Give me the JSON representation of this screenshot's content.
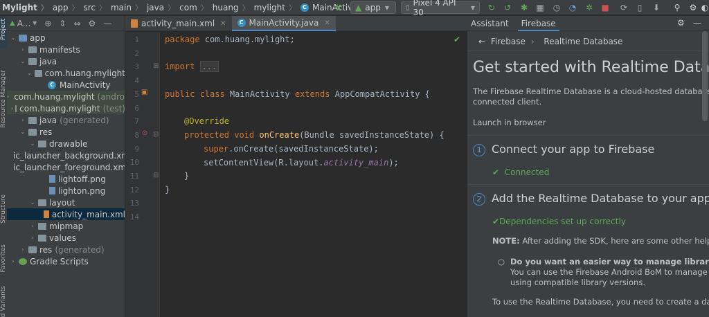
{
  "breadcrumb": [
    "Mylight",
    "app",
    "src",
    "main",
    "java",
    "com",
    "huang",
    "mylight",
    "MainActivity"
  ],
  "toolbar": {
    "config": "app",
    "device": "Pixel 4 API 30"
  },
  "left_strip": {
    "project": "Project",
    "resource_manager": "Resource Manager",
    "structure": "Structure",
    "favorites": "Favorites",
    "build_variants": "Build Variants"
  },
  "project_panel": {
    "title": "A..."
  },
  "tree": [
    {
      "label": "app",
      "level": 0,
      "type": "folder-blue",
      "expanded": true
    },
    {
      "label": "manifests",
      "level": 1,
      "type": "folder",
      "expanded": false
    },
    {
      "label": "java",
      "level": 1,
      "type": "folder",
      "expanded": true
    },
    {
      "label": "com.huang.mylight",
      "level": 2,
      "type": "package",
      "expanded": true
    },
    {
      "label": "MainActivity",
      "level": 3,
      "type": "class"
    },
    {
      "label": "com.huang.mylight",
      "suffix": "(androidTest)",
      "level": 2,
      "type": "package",
      "expanded": false,
      "highlight": true
    },
    {
      "label": "com.huang.mylight",
      "suffix": "(test)",
      "level": 2,
      "type": "package",
      "expanded": false,
      "highlight": true
    },
    {
      "label": "java",
      "suffix": "(generated)",
      "level": 1,
      "type": "folder",
      "expanded": false
    },
    {
      "label": "res",
      "level": 1,
      "type": "folder",
      "expanded": true
    },
    {
      "label": "drawable",
      "level": 2,
      "type": "folder",
      "expanded": true
    },
    {
      "label": "ic_launcher_background.xml",
      "level": 3,
      "type": "xml"
    },
    {
      "label": "ic_launcher_foreground.xml",
      "level": 3,
      "type": "xml"
    },
    {
      "label": "lightoff.png",
      "level": 3,
      "type": "img"
    },
    {
      "label": "lighton.png",
      "level": 3,
      "type": "img"
    },
    {
      "label": "layout",
      "level": 2,
      "type": "folder",
      "expanded": true
    },
    {
      "label": "activity_main.xml",
      "level": 3,
      "type": "xml",
      "selected": true
    },
    {
      "label": "mipmap",
      "level": 2,
      "type": "folder",
      "expanded": false
    },
    {
      "label": "values",
      "level": 2,
      "type": "folder",
      "expanded": false
    },
    {
      "label": "res",
      "suffix": "(generated)",
      "level": 1,
      "type": "folder",
      "expanded": false
    },
    {
      "label": "Gradle Scripts",
      "level": 0,
      "type": "gradle",
      "expanded": false
    }
  ],
  "editor_tabs": [
    {
      "label": "activity_main.xml",
      "active": false
    },
    {
      "label": "MainActivity.java",
      "active": true
    }
  ],
  "code_lines": [
    "1",
    "2",
    "3",
    "4",
    "5",
    "6",
    "7",
    "8",
    "9",
    "10",
    "11",
    "12",
    "13",
    "14"
  ],
  "code": {
    "l1_kw": "package ",
    "l1_rest": "com.huang.mylight;",
    "l3_kw": "import ",
    "l3_fold": "...",
    "l5_kw1": "public class ",
    "l5_name": "MainActivity ",
    "l5_kw2": "extends ",
    "l5_rest": "AppCompatActivity {",
    "l7_an": "@Override",
    "l8_kw": "protected void ",
    "l8_fn": "onCreate",
    "l8_rest": "(Bundle savedInstanceState) {",
    "l9_kw": "super",
    "l9_rest": ".onCreate(savedInstanceState);",
    "l10_a": "setContentView(R.layout.",
    "l10_it": "activity_main",
    "l10_b": ");",
    "l11": "}",
    "l12": "}"
  },
  "assistant": {
    "tabs": [
      "Assistant",
      "Firebase"
    ],
    "back_label": "Firebase",
    "crumb_current": "Realtime Database",
    "heading": "Get started with Realtime Database",
    "intro_1": "The Firebase Realtime Database is a cloud-hosted database. Data is stored as JSON and synchronized in realtime to every",
    "intro_2": "connected client.",
    "launch": "Launch in browser",
    "step1_num": "1",
    "step1_title": "Connect your app to Firebase",
    "step1_status": "Connected",
    "step2_num": "2",
    "step2_title": "Add the Realtime Database to your app",
    "step2_status": "Dependencies set up correctly",
    "note_label": "NOTE:",
    "note_text": " After adding the SDK, here are some other helpful configurations to consider:",
    "bullet_title": "Do you want an easier way to manage library versions?",
    "bullet_1": "You can use the Firebase Android BoM to manage your Firebase library versions to ensure that your app is always",
    "bullet_2": "using compatible library versions.",
    "use_text": "To use the Realtime Database, you need to create a database."
  },
  "colors": {
    "accent": "#4a88c7",
    "success": "#5fa85a",
    "keyword": "#cc7832",
    "annotation": "#bbb529",
    "function": "#ffc66d"
  }
}
